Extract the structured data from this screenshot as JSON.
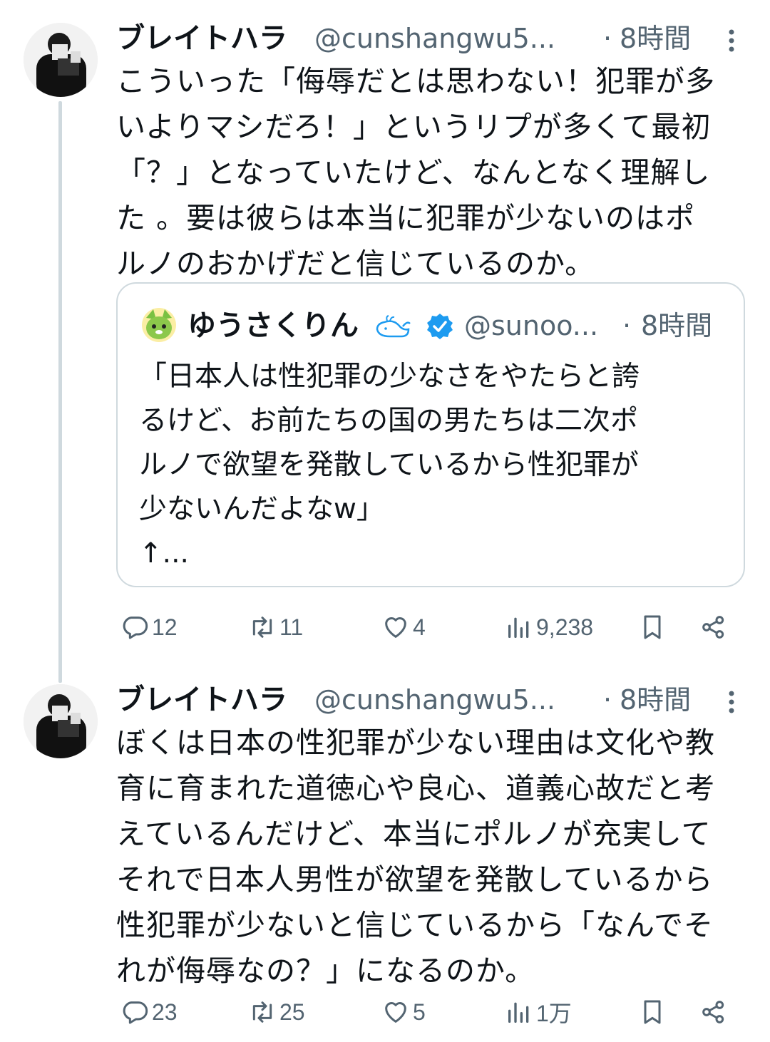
{
  "tweets": [
    {
      "name": "ブレイトハラ",
      "handle": "@cunshangwu5...",
      "dot": "·",
      "time": "8時間",
      "text": "こういった「侮辱だとは思わない！犯罪が多\nいよりマシだろ！」というリプが多くて最初\n「？」となっていたけど、なんとなく理解し\nた 。要は彼らは本当に犯罪が少ないのはポ\nルノのおかげだと信じているのか。",
      "quote": {
        "name": "ゆうさくりん",
        "handle": "@sunoo...",
        "dot": "·",
        "time": "8時間",
        "text": "「日本人は性犯罪の少なさをやたらと誇\nるけど、お前たちの国の男たちは二次ポ\nルノで欲望を発散しているから性犯罪が\n少ないんだよなw」\n↑..."
      },
      "stats": {
        "replies": "12",
        "retweets": "11",
        "likes": "4",
        "views": "9,238"
      }
    },
    {
      "name": "ブレイトハラ",
      "handle": "@cunshangwu5...",
      "dot": "·",
      "time": "8時間",
      "text": "ぼくは日本の性犯罪が少ない理由は文化や教\n育に育まれた道徳心や良心、道義心故だと考\nえているんだけど、本当にポルノが充実して\nそれで日本人男性が欲望を発散しているから\n性犯罪が少ないと信じているから「なんでそ\nれが侮辱なの？」になるのか。",
      "stats": {
        "replies": "23",
        "retweets": "25",
        "likes": "5",
        "views": "1万"
      }
    }
  ],
  "colors": {
    "text": "#0f1419",
    "secondary": "#536471",
    "verified": "#1d9bf0",
    "border": "#cfd9de"
  },
  "icons": [
    "reply-icon",
    "retweet-icon",
    "like-icon",
    "views-icon",
    "bookmark-icon",
    "share-icon",
    "more-icon",
    "verified-badge-icon",
    "whale-emoji-icon"
  ]
}
